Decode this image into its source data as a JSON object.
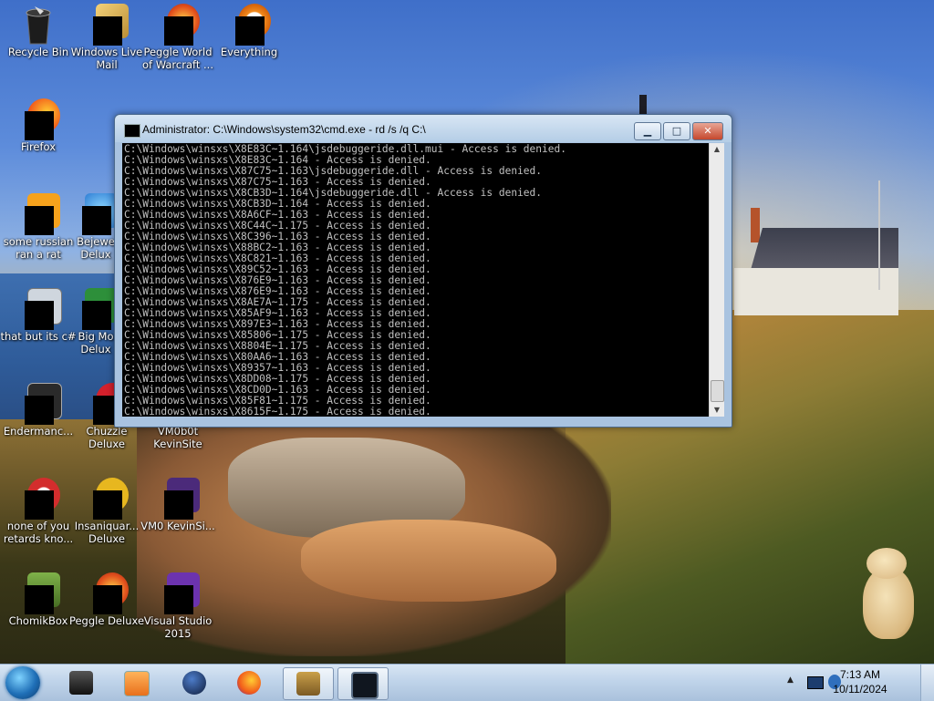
{
  "desktop_icons": [
    {
      "label": "Recycle Bin",
      "icon": "recycle-bin-icon"
    },
    {
      "label": "Windows Live Mail",
      "icon": "mail-icon"
    },
    {
      "label": "Peggle World of Warcraft ...",
      "icon": "peggle-icon"
    },
    {
      "label": "Everything",
      "icon": "search-icon"
    },
    {
      "label": "Firefox",
      "icon": "firefox-icon"
    },
    {
      "label": "some russian ran a rat",
      "icon": "app-icon"
    },
    {
      "label": "Bejewe Delux",
      "icon": "bejeweled-icon"
    },
    {
      "label": "that but its c#",
      "icon": "app-icon"
    },
    {
      "label": "Big Mo Delux",
      "icon": "game-icon"
    },
    {
      "label": "Endermanc...",
      "icon": "app-icon"
    },
    {
      "label": "Chuzzle Deluxe",
      "icon": "chuzzle-icon"
    },
    {
      "label": "VM0b0t KevinSite",
      "icon": "shortcut-icon"
    },
    {
      "label": "none of you retards kno...",
      "icon": "app-icon"
    },
    {
      "label": "Insaniquar... Deluxe",
      "icon": "game-icon"
    },
    {
      "label": "VM0 KevinSi...",
      "icon": "shortcut-icon"
    },
    {
      "label": "ChomikBox",
      "icon": "chomikbox-icon"
    },
    {
      "label": "Peggle Deluxe",
      "icon": "peggle-icon"
    },
    {
      "label": "Visual Studio 2015",
      "icon": "visual-studio-icon"
    }
  ],
  "cmd_window": {
    "title": "Administrator: C:\\Windows\\system32\\cmd.exe - rd  /s /q C:\\",
    "minimize_glyph": "▁",
    "maximize_glyph": "□",
    "close_glyph": "✕",
    "scroll_up_glyph": "▲",
    "scroll_down_glyph": "▼",
    "lines": [
      "C:\\Windows\\winsxs\\X8E83C~1.164\\jsdebuggeride.dll.mui - Access is denied.",
      "C:\\Windows\\winsxs\\X8E83C~1.164 - Access is denied.",
      "C:\\Windows\\winsxs\\X87C75~1.163\\jsdebuggeride.dll - Access is denied.",
      "C:\\Windows\\winsxs\\X87C75~1.163 - Access is denied.",
      "C:\\Windows\\winsxs\\X8CB3D~1.164\\jsdebuggeride.dll - Access is denied.",
      "C:\\Windows\\winsxs\\X8CB3D~1.164 - Access is denied.",
      "C:\\Windows\\winsxs\\X8A6CF~1.163 - Access is denied.",
      "C:\\Windows\\winsxs\\X8C44C~1.175 - Access is denied.",
      "C:\\Windows\\winsxs\\X8C396~1.163 - Access is denied.",
      "C:\\Windows\\winsxs\\X88BC2~1.163 - Access is denied.",
      "C:\\Windows\\winsxs\\X8C821~1.163 - Access is denied.",
      "C:\\Windows\\winsxs\\X89C52~1.163 - Access is denied.",
      "C:\\Windows\\winsxs\\X876E9~1.163 - Access is denied.",
      "C:\\Windows\\winsxs\\X876E9~1.163 - Access is denied.",
      "C:\\Windows\\winsxs\\X8AE7A~1.175 - Access is denied.",
      "C:\\Windows\\winsxs\\X85AF9~1.163 - Access is denied.",
      "C:\\Windows\\winsxs\\X897E3~1.163 - Access is denied.",
      "C:\\Windows\\winsxs\\X85806~1.175 - Access is denied.",
      "C:\\Windows\\winsxs\\X8804E~1.175 - Access is denied.",
      "C:\\Windows\\winsxs\\X80AA6~1.163 - Access is denied.",
      "C:\\Windows\\winsxs\\X89357~1.163 - Access is denied.",
      "C:\\Windows\\winsxs\\X8DD08~1.175 - Access is denied.",
      "C:\\Windows\\winsxs\\X8CD0D~1.163 - Access is denied.",
      "C:\\Windows\\winsxs\\X85F81~1.175 - Access is denied.",
      "C:\\Windows\\winsxs\\X8615F~1.175 - Access is denied."
    ]
  },
  "taskbar": {
    "items": [
      {
        "icon": "terminal-icon",
        "active": false
      },
      {
        "icon": "media-player-icon",
        "active": false
      },
      {
        "icon": "globe-icon",
        "active": false
      },
      {
        "icon": "firefox-icon",
        "active": false
      },
      {
        "icon": "chomikbox-icon",
        "active": true
      },
      {
        "icon": "cmd-icon",
        "active": true
      }
    ],
    "tray": {
      "show_hidden_glyph": "▲",
      "time": "7:13 AM",
      "date": "10/11/2024"
    }
  },
  "colors": {
    "console_bg": "#000000",
    "console_text": "#c0c0c0",
    "taskbar": "#b8cde5",
    "close_button": "#c5482d"
  }
}
